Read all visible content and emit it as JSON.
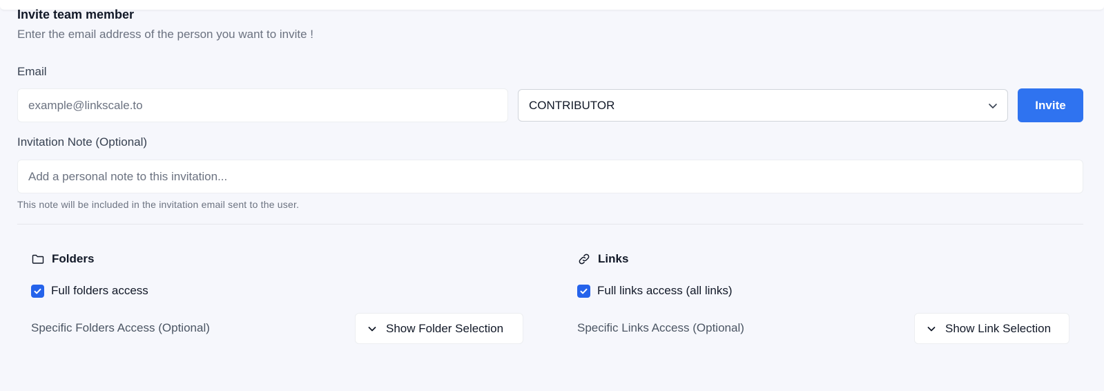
{
  "header": {
    "title": "Invite team member",
    "subtitle": "Enter the email address of the person you want to invite !"
  },
  "email": {
    "label": "Email",
    "placeholder": "example@linkscale.to",
    "value": ""
  },
  "role_select": {
    "selected": "CONTRIBUTOR"
  },
  "invite_button": {
    "label": "Invite",
    "color": "#2f73f0"
  },
  "note": {
    "label": "Invitation Note (Optional)",
    "placeholder": "Add a personal note to this invitation...",
    "hint": "This note will be included in the invitation email sent to the user."
  },
  "folders": {
    "icon": "folder-icon",
    "title": "Folders",
    "full_access_label": "Full folders access",
    "full_access_checked": true,
    "specific_label": "Specific Folders Access (Optional)",
    "show_button_label": "Show Folder Selection"
  },
  "links": {
    "icon": "link-icon",
    "title": "Links",
    "full_access_label": "Full links access (all links)",
    "full_access_checked": true,
    "specific_label": "Specific Links Access (Optional)",
    "show_button_label": "Show Link Selection"
  },
  "colors": {
    "accent": "#2563eb",
    "checkbox": "#2563eb"
  }
}
